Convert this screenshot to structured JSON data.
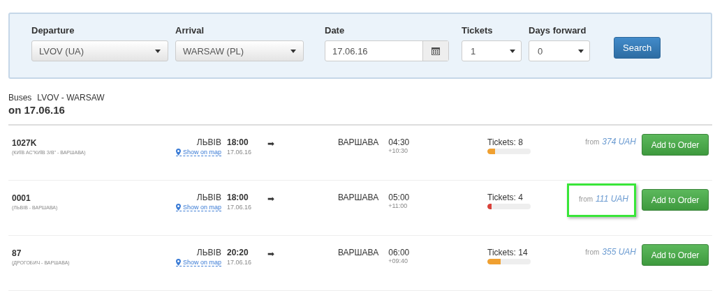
{
  "search_form": {
    "fields": [
      {
        "kind": "select",
        "label": "Departure",
        "value": "LVOV (UA)"
      },
      {
        "kind": "select",
        "label": "Arrival",
        "value": "WARSAW (PL)"
      },
      {
        "kind": "date",
        "label": "Date",
        "value": "17.06.16"
      },
      {
        "kind": "small_select",
        "label": "Tickets",
        "value": "1"
      },
      {
        "kind": "small_select",
        "label": "Days forward",
        "value": "0"
      }
    ],
    "button": "Search"
  },
  "results_header": {
    "prefix": "Buses",
    "route": "LVOV - WARSAW",
    "date": "on 17.06.16"
  },
  "trips": [
    {
      "number": "1027K",
      "route": "(КИЇВ АС\"КИЇВ З/В\" - ВАРШАВА)",
      "from": "ЛЬВІВ",
      "map_link": "Show on map",
      "depart_time": "18:00",
      "depart_date": "17.06.16",
      "arrow": "➡",
      "to": "ВАРШАВА",
      "arrive_time": "04:30",
      "duration": "+10:30",
      "tickets": "Tickets: 8",
      "level": 0.18,
      "color": "#f0a030",
      "price_prefix": "from",
      "price": "374 UAH",
      "highlighted": false,
      "button": "Add to Order"
    },
    {
      "number": "0001",
      "route": "(ЛЬВІВ - ВАРШАВА)",
      "from": "ЛЬВІВ",
      "map_link": "Show on map",
      "depart_time": "18:00",
      "depart_date": "17.06.16",
      "arrow": "➡",
      "to": "ВАРШАВА",
      "arrive_time": "05:00",
      "duration": "+11:00",
      "tickets": "Tickets: 4",
      "level": 0.09,
      "color": "#d9413a",
      "price_prefix": "from",
      "price": "111 UAH",
      "highlighted": true,
      "button": "Add to Order"
    },
    {
      "number": "87",
      "route": "(ДРОГОБИЧ - ВАРШАВА)",
      "from": "ЛЬВІВ",
      "map_link": "Show on map",
      "depart_time": "20:20",
      "depart_date": "17.06.16",
      "arrow": "➡",
      "to": "ВАРШАВА",
      "arrive_time": "06:00",
      "duration": "+09:40",
      "tickets": "Tickets: 14",
      "level": 0.31,
      "color": "#f0a030",
      "price_prefix": "from",
      "price": "355 UAH",
      "highlighted": false,
      "button": "Add to Order"
    }
  ]
}
